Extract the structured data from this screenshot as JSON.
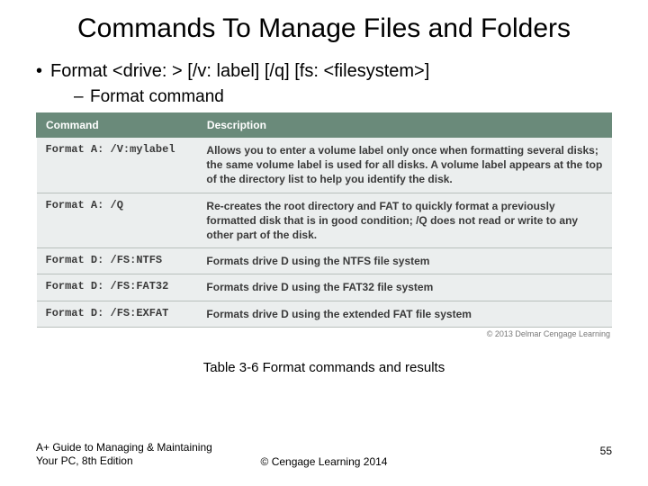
{
  "title": "Commands To Manage Files and Folders",
  "bullets": {
    "b1": "Format <drive: > [/v: label] [/q] [fs: <filesystem>]",
    "b2": "Format command"
  },
  "chart_data": {
    "type": "table",
    "title": "Table 3-6 Format commands and results",
    "headers": [
      "Command",
      "Description"
    ],
    "rows": [
      {
        "command": "Format A: /V:mylabel",
        "description": "Allows you to enter a volume label only once when formatting several disks; the same volume label is used for all disks. A volume label appears at the top of the directory list to help you identify the disk."
      },
      {
        "command": "Format A: /Q",
        "description": "Re-creates the root directory and FAT to quickly format a previously formatted disk that is in good condition; /Q does not read or write to any other part of the disk."
      },
      {
        "command": "Format D: /FS:NTFS",
        "description": "Formats drive D using the NTFS file system"
      },
      {
        "command": "Format D: /FS:FAT32",
        "description": "Formats drive D using the FAT32 file system"
      },
      {
        "command": "Format D: /FS:EXFAT",
        "description": "Formats drive D using the extended FAT file system"
      }
    ]
  },
  "table_credit": "© 2013 Delmar Cengage Learning",
  "caption": "Table 3-6 Format commands and results",
  "footer": {
    "left": "A+ Guide to Managing & Maintaining Your PC, 8th Edition",
    "center": "© Cengage Learning  2014",
    "right": "55"
  }
}
